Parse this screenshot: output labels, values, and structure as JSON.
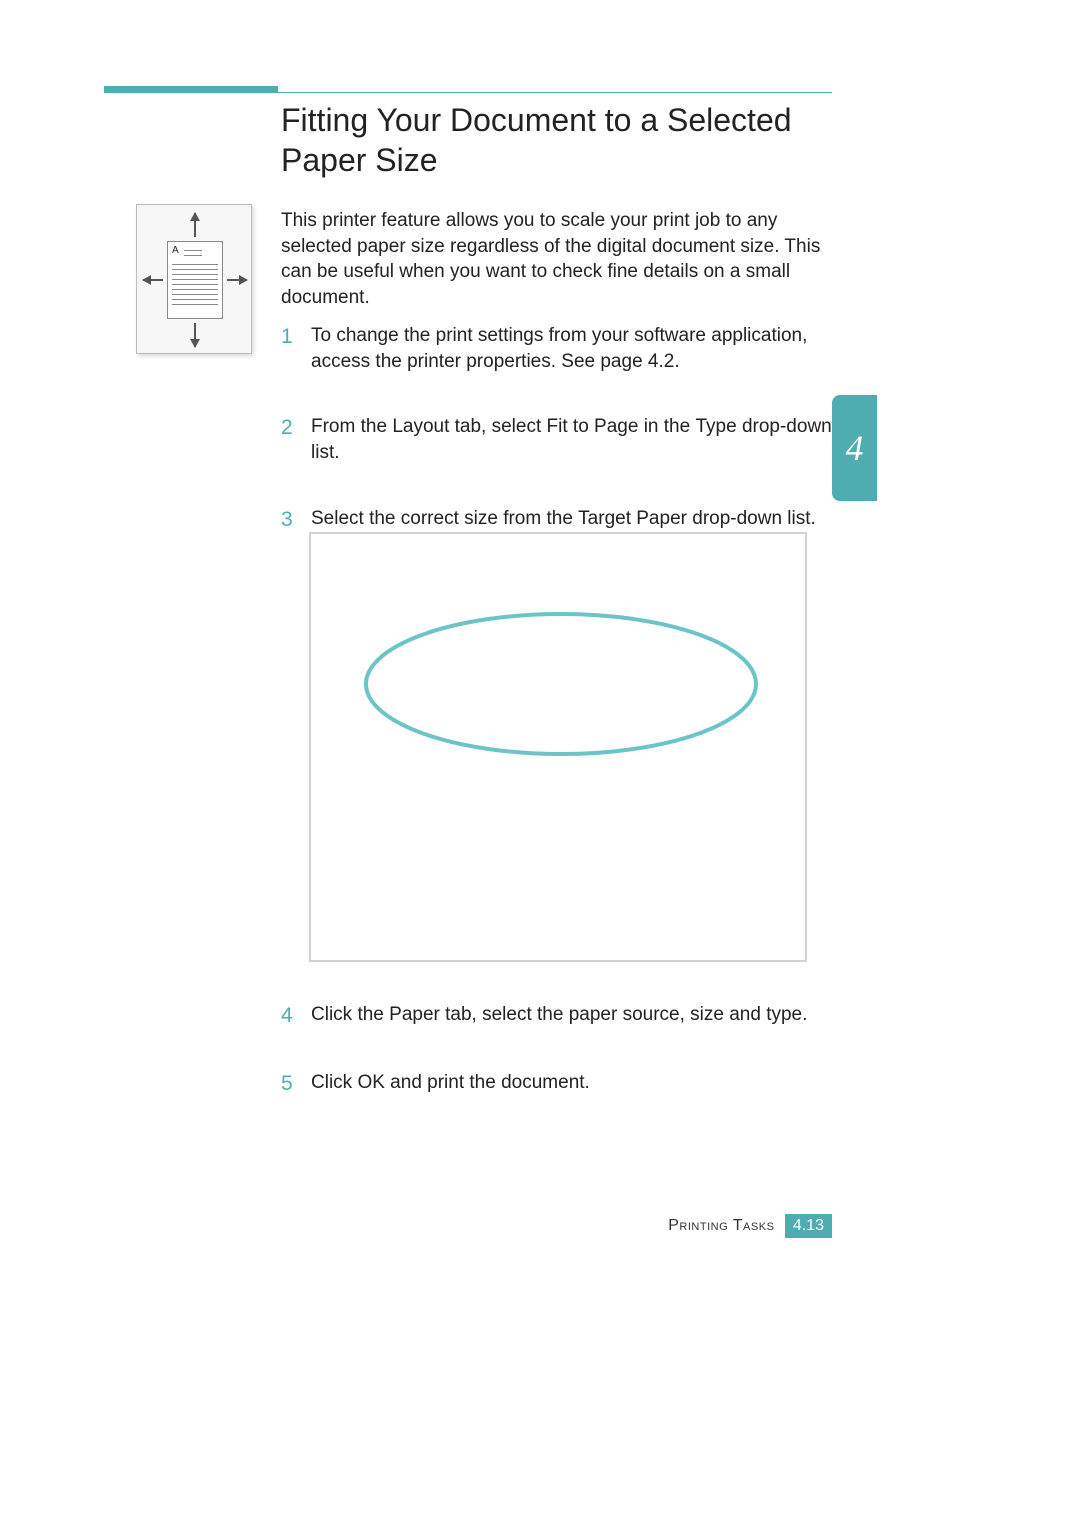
{
  "title": "Fitting Your Document to a Selected Paper Size",
  "sideFigure": {
    "label": "A"
  },
  "intro": "This printer feature allows you to scale your print job to any selected paper size regardless of the digital document size. This can be useful when you want to check fine details on a small document.",
  "steps": [
    {
      "num": "1",
      "parts": [
        "To change the print settings from your software application, access the printer properties. See page 4.2."
      ]
    },
    {
      "num": "2",
      "parts": [
        "From the ",
        "Layout",
        " tab, select ",
        "Fit to Page",
        " in the ",
        "Type",
        " drop-down list."
      ]
    },
    {
      "num": "3",
      "parts": [
        "Select the correct size from the ",
        "Target Paper",
        " drop-down list."
      ]
    },
    {
      "num": "4",
      "parts": [
        "Click the ",
        "Paper",
        " tab, select the paper source, size and type."
      ]
    },
    {
      "num": "5",
      "parts": [
        "Click ",
        "OK",
        " and print the document."
      ]
    }
  ],
  "chapterTab": "4",
  "footer": {
    "section": "Printing Tasks",
    "page": "4.13"
  },
  "colors": {
    "accent": "#4dadb0"
  }
}
